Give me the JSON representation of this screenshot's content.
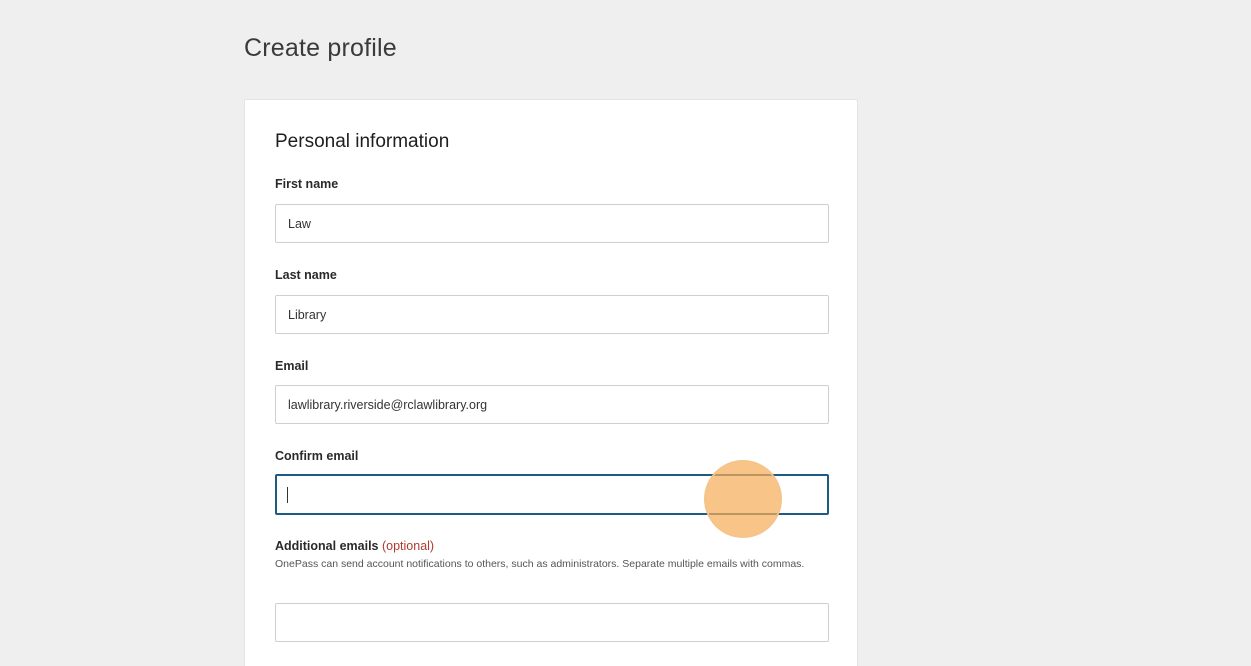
{
  "page": {
    "title": "Create profile"
  },
  "form": {
    "section_heading": "Personal information",
    "first_name": {
      "label": "First name",
      "value": "Law"
    },
    "last_name": {
      "label": "Last name",
      "value": "Library"
    },
    "email": {
      "label": "Email",
      "value": "lawlibrary.riverside@rclawlibrary.org"
    },
    "confirm_email": {
      "label": "Confirm email",
      "value": ""
    },
    "additional_emails": {
      "label": "Additional emails",
      "optional_tag": "(optional)",
      "help_text": "OnePass can send account notifications to others, such as administrators. Separate multiple emails with commas.",
      "value": ""
    }
  },
  "colors": {
    "background": "#efeff0",
    "card": "#ffffff",
    "focus_border": "#1f5a82",
    "optional_text": "#b03a2e",
    "click_indicator": "#f7ad5a"
  }
}
